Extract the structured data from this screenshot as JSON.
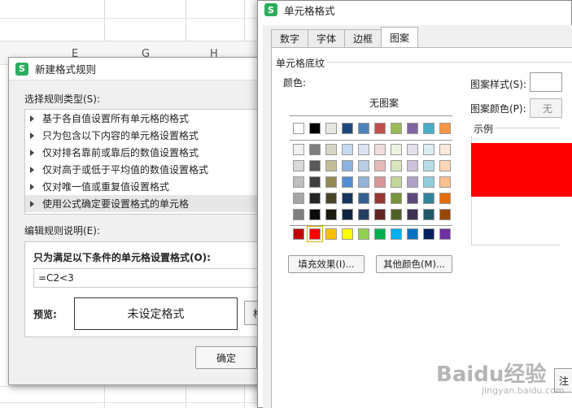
{
  "sheet": {
    "columns": [
      "E",
      "G",
      "H"
    ]
  },
  "rule_dialog": {
    "title": "新建格式规则",
    "select_type_label": "选择规则类型(S):",
    "rule_types": [
      "基于各自值设置所有单元格的格式",
      "只为包含以下内容的单元格设置格式",
      "仅对排名靠前或靠后的数值设置格式",
      "仅对高于或低于平均值的数值设置格式",
      "仅对唯一值或重复值设置格式",
      "使用公式确定要设置格式的单元格"
    ],
    "selected_rule_index": 5,
    "edit_desc_label": "编辑规则说明(E):",
    "condition_title": "只为满足以下条件的单元格设置格式(O):",
    "formula_value": "=C2<3",
    "preview_label": "预览:",
    "preview_text": "未设定格式",
    "format_button": "格式",
    "ok_button": "确定"
  },
  "cell_dialog": {
    "title": "单元格格式",
    "tabs": [
      "数字",
      "字体",
      "边框",
      "图案"
    ],
    "active_tab": "图案",
    "shading_group": "单元格底纹",
    "color_label": "颜色:",
    "no_pattern": "无图案",
    "pattern_style_label": "图案样式(S):",
    "pattern_color_label": "图案颜色(P):",
    "pattern_color_value": "无",
    "example_label": "示例",
    "example_color": "#ff0000",
    "fill_effect_button": "填充效果(I)...",
    "other_color_button": "其他颜色(M)...",
    "corner_button": "注",
    "palette": {
      "theme_top": [
        "#ffffff",
        "#000000",
        "#e7e6e0",
        "#1f497d",
        "#4f81bd",
        "#c0504d",
        "#9bbb59",
        "#8064a2",
        "#4bacc6",
        "#f79646"
      ],
      "theme_shades": [
        [
          "#f2f2f2",
          "#7f7f7f",
          "#d8d5c4",
          "#c6d9f0",
          "#dbe5f1",
          "#f2dcdb",
          "#ebf1dd",
          "#e5e0ec",
          "#dbeef3",
          "#fdeada"
        ],
        [
          "#d8d8d8",
          "#595959",
          "#c4bd97",
          "#8db3e2",
          "#b8cce4",
          "#e5b9b7",
          "#d7e3bc",
          "#ccc1d9",
          "#b7dde8",
          "#fbd5b5"
        ],
        [
          "#bfbfbf",
          "#3f3f3f",
          "#938953",
          "#548dd4",
          "#95b3d7",
          "#d99694",
          "#c3d69b",
          "#b2a2c7",
          "#92cddc",
          "#fac08f"
        ],
        [
          "#a5a5a5",
          "#262626",
          "#494429",
          "#17365d",
          "#366092",
          "#953734",
          "#76923c",
          "#5f497a",
          "#31859b",
          "#e36c09"
        ],
        [
          "#7f7f7f",
          "#0c0c0c",
          "#1d1b10",
          "#0f243e",
          "#244061",
          "#632423",
          "#4f6128",
          "#3f3151",
          "#205867",
          "#974806"
        ]
      ],
      "standard": [
        "#c00000",
        "#ff0000",
        "#ffc000",
        "#ffff00",
        "#92d050",
        "#00b050",
        "#00b0f0",
        "#0070c0",
        "#002060",
        "#7030a0"
      ],
      "selected_standard_index": 1
    }
  },
  "watermark": {
    "brand": "Baidu经验",
    "url": "jingyan.baidu.com"
  }
}
